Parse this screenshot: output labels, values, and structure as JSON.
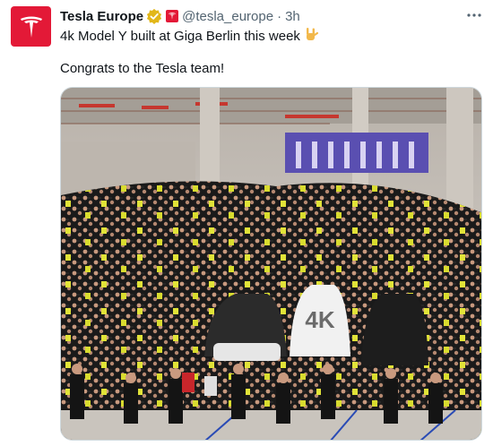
{
  "author": {
    "display_name": "Tesla Europe",
    "handle": "@tesla_europe",
    "time": "3h",
    "avatar_color": "#e31937",
    "verified_badge": "gold-verified-icon",
    "affiliation_badge": "tesla-logo-icon"
  },
  "tweet": {
    "line1": "4k Model Y built at Giga Berlin this week",
    "emoji": "rock-on-hand-icon",
    "line2": "Congrats to the Tesla team!"
  },
  "media": {
    "sign_text": "4K",
    "description_icon": "crowd-photo"
  },
  "more_icon": "more-horizontal-icon"
}
